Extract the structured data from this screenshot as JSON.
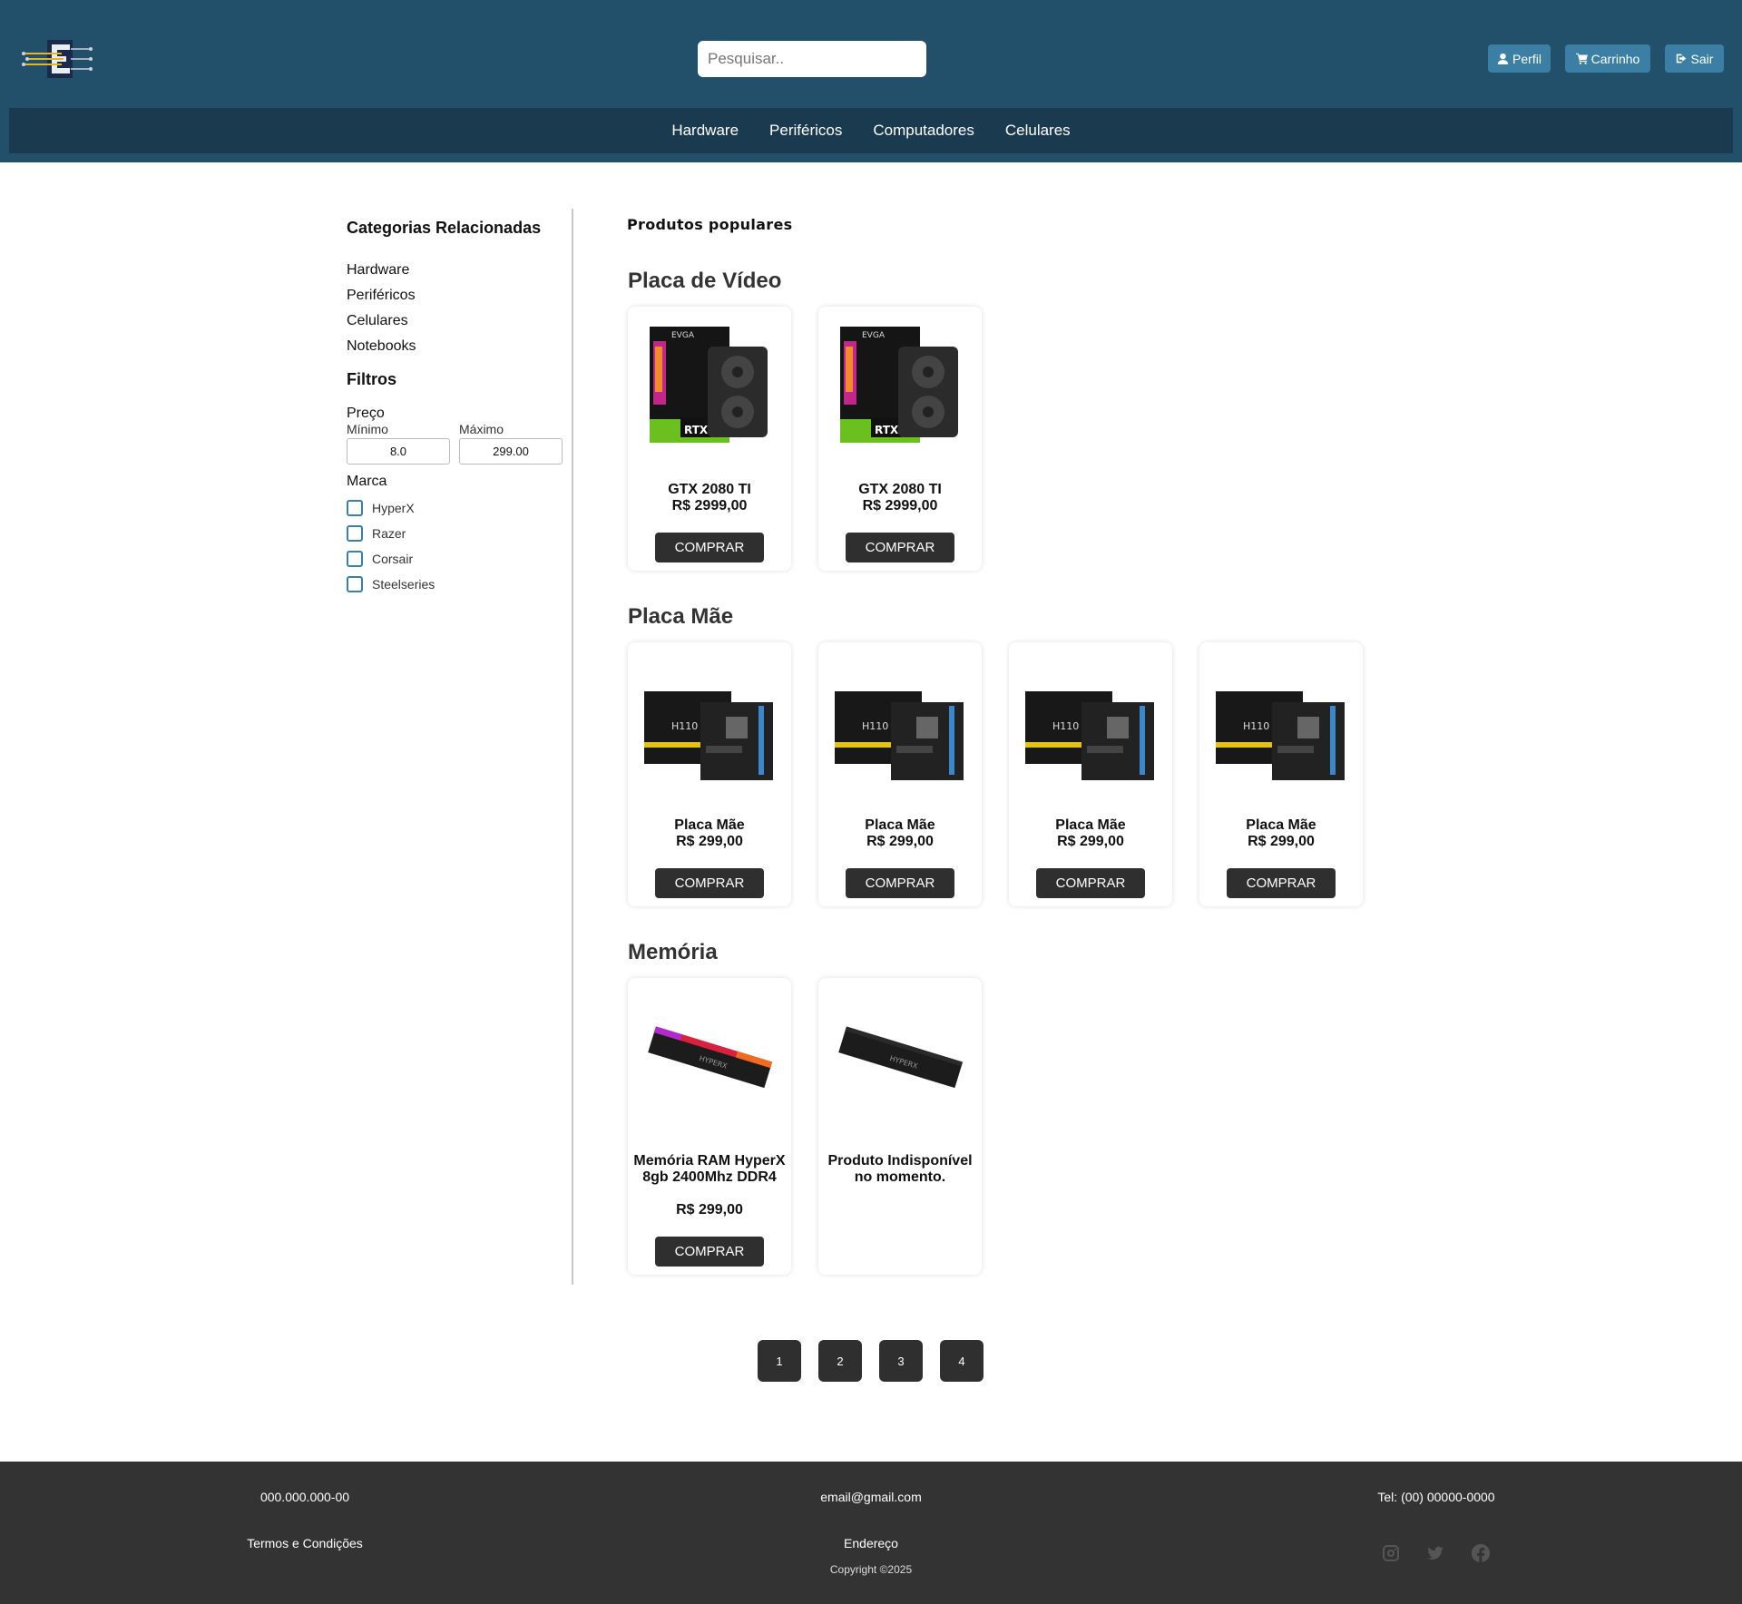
{
  "header": {
    "search_placeholder": "Pesquisar..",
    "profile_label": "Perfil",
    "cart_label": "Carrinho",
    "logout_label": "Sair",
    "accent_color": "#3b7fa4",
    "background_color": "#224f6a"
  },
  "nav": {
    "items": [
      "Hardware",
      "Periféricos",
      "Computadores",
      "Celulares"
    ]
  },
  "sidebar": {
    "categories_title": "Categorias Relacionadas",
    "categories": [
      "Hardware",
      "Periféricos",
      "Celulares",
      "Notebooks"
    ],
    "filters_title": "Filtros",
    "price_label": "Preço",
    "min_label": "Mínimo",
    "max_label": "Máximo",
    "min_value": "8.0",
    "max_value": "299.00",
    "brand_label": "Marca",
    "brands": [
      "HyperX",
      "Razer",
      "Corsair",
      "Steelseries"
    ]
  },
  "main": {
    "popular_title": "Produtos populares",
    "buy_label": "COMPRAR",
    "sections": [
      {
        "title": "Placa de Vídeo",
        "products": [
          {
            "name": "GTX 2080 TI",
            "price": "R$ 2999,00",
            "image": "gpu-image"
          },
          {
            "name": "GTX 2080 TI",
            "price": "R$ 2999,00",
            "image": "gpu-image"
          }
        ]
      },
      {
        "title": "Placa Mãe",
        "products": [
          {
            "name": "Placa Mãe",
            "price": "R$ 299,00",
            "image": "motherboard-image"
          },
          {
            "name": "Placa Mãe",
            "price": "R$ 299,00",
            "image": "motherboard-image"
          },
          {
            "name": "Placa Mãe",
            "price": "R$ 299,00",
            "image": "motherboard-image"
          },
          {
            "name": "Placa Mãe",
            "price": "R$ 299,00",
            "image": "motherboard-image"
          }
        ]
      },
      {
        "title": "Memória",
        "products": [
          {
            "name": "Memória RAM HyperX 8gb 2400Mhz DDR4",
            "price": "R$ 299,00",
            "image": "ram-rgb-image"
          },
          {
            "name": "Produto Indisponível no momento.",
            "price": "",
            "image": "ram-image",
            "unavailable": true
          }
        ]
      }
    ]
  },
  "pagination": [
    "1",
    "2",
    "3",
    "4"
  ],
  "footer": {
    "document": "000.000.000-00",
    "email": "email@gmail.com",
    "phone": "Tel: (00) 00000-0000",
    "terms": "Termos e Condições",
    "address": "Endereço",
    "copyright": "Copyright ©2025",
    "social_icons": [
      "instagram-icon",
      "twitter-icon",
      "facebook-icon"
    ]
  }
}
